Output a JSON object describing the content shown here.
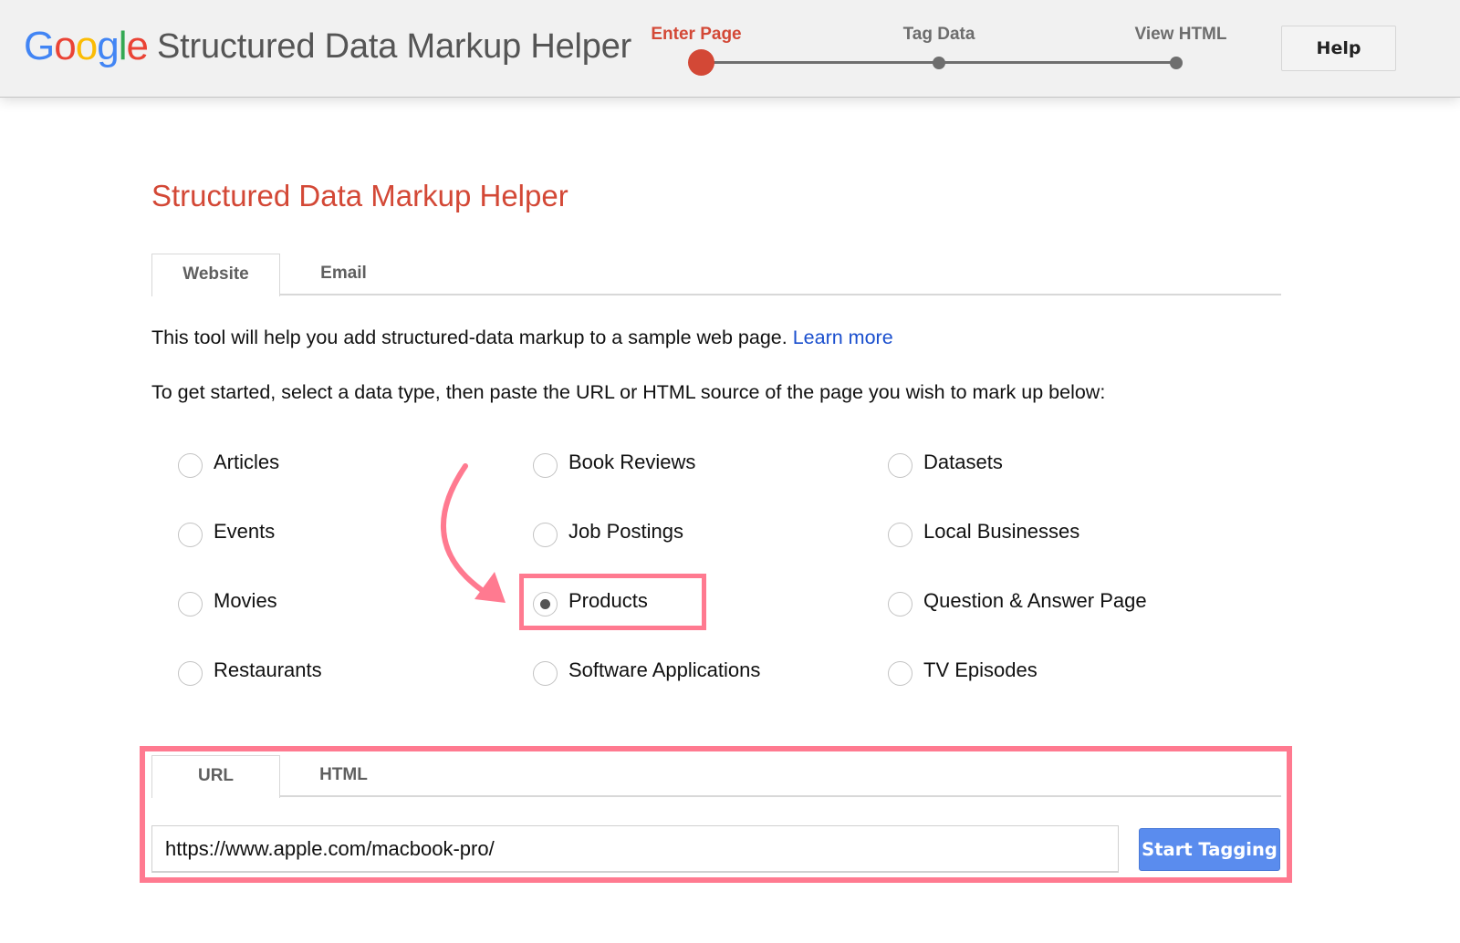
{
  "header": {
    "logo_letters": [
      {
        "char": "G",
        "color": "#4285f4"
      },
      {
        "char": "o",
        "color": "#ea4335"
      },
      {
        "char": "o",
        "color": "#fbbc05"
      },
      {
        "char": "g",
        "color": "#4285f4"
      },
      {
        "char": "l",
        "color": "#34a853"
      },
      {
        "char": "e",
        "color": "#ea4335"
      }
    ],
    "app_title": "Structured Data Markup Helper",
    "steps": [
      {
        "label": "Enter Page",
        "active": true
      },
      {
        "label": "Tag Data",
        "active": false
      },
      {
        "label": "View HTML",
        "active": false
      }
    ],
    "help_label": "Help"
  },
  "main": {
    "title": "Structured Data Markup Helper",
    "source_tabs": [
      {
        "label": "Website",
        "active": true
      },
      {
        "label": "Email",
        "active": false
      }
    ],
    "intro_text": "This tool will help you add structured-data markup to a sample web page. ",
    "learn_more": "Learn more",
    "instructions": "To get started, select a data type, then paste the URL or HTML source of the page you wish to mark up below:",
    "data_types": [
      {
        "label": "Articles",
        "checked": false
      },
      {
        "label": "Book Reviews",
        "checked": false
      },
      {
        "label": "Datasets",
        "checked": false
      },
      {
        "label": "Events",
        "checked": false
      },
      {
        "label": "Job Postings",
        "checked": false
      },
      {
        "label": "Local Businesses",
        "checked": false
      },
      {
        "label": "Movies",
        "checked": false
      },
      {
        "label": "Products",
        "checked": true
      },
      {
        "label": "Question & Answer Page",
        "checked": false
      },
      {
        "label": "Restaurants",
        "checked": false
      },
      {
        "label": "Software Applications",
        "checked": false
      },
      {
        "label": "TV Episodes",
        "checked": false
      }
    ],
    "input_tabs": [
      {
        "label": "URL",
        "active": true
      },
      {
        "label": "HTML",
        "active": false
      }
    ],
    "url_value": "https://www.apple.com/macbook-pro/",
    "start_button": "Start Tagging"
  },
  "colors": {
    "accent_red": "#d34836",
    "link_blue": "#1a4fce",
    "button_blue": "#5a8cee",
    "annotation_pink": "#ff7a90"
  }
}
